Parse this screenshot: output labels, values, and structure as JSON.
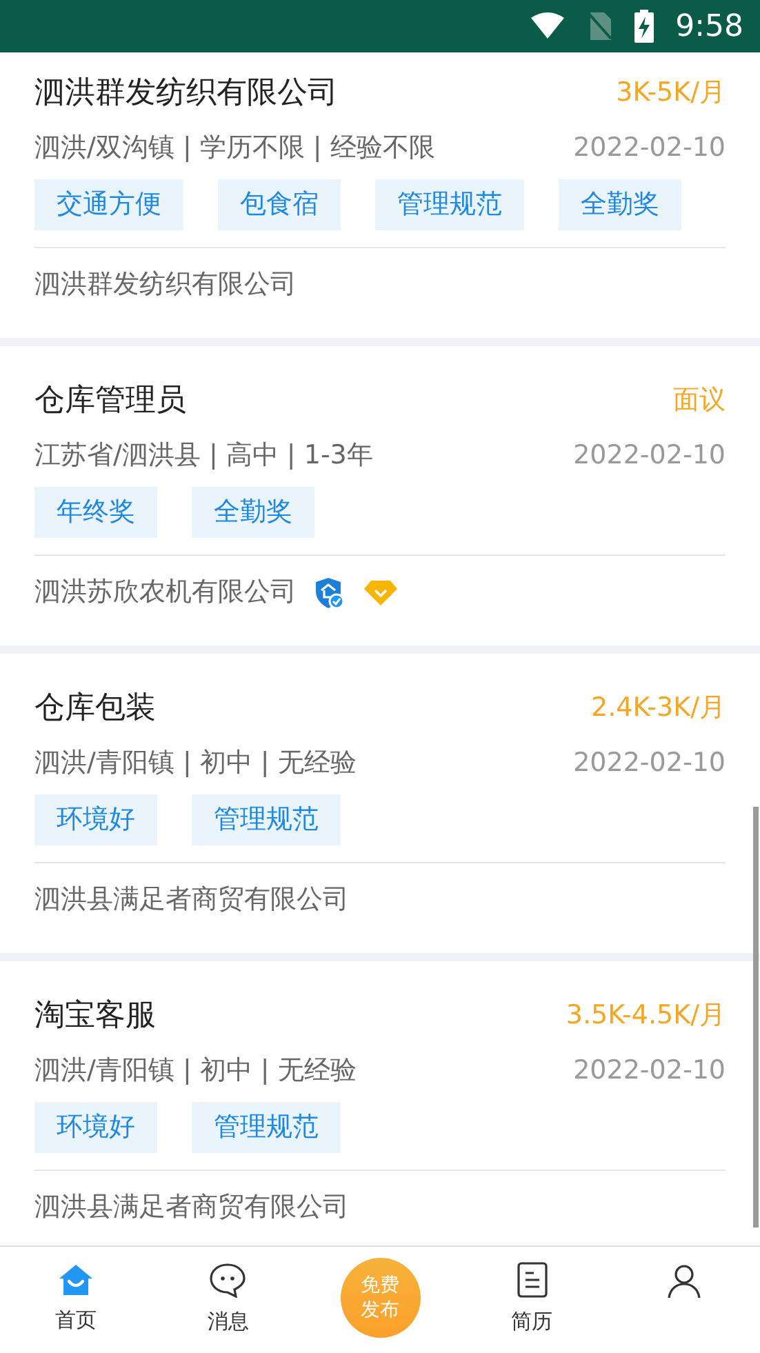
{
  "status_bar": {
    "time": "9:58"
  },
  "jobs": [
    {
      "title": "泗洪群发纺织有限公司",
      "salary": "3K-5K/月",
      "info": "泗洪/双沟镇 | 学历不限 | 经验不限",
      "date": "2022-02-10",
      "tags": [
        "交通方便",
        "包食宿",
        "管理规范",
        "全勤奖"
      ],
      "company": "泗洪群发纺织有限公司",
      "verified": false,
      "vip": false
    },
    {
      "title": "仓库管理员",
      "salary": "面议",
      "info": "江苏省/泗洪县 | 高中 | 1-3年",
      "date": "2022-02-10",
      "tags": [
        "年终奖",
        "全勤奖"
      ],
      "company": "泗洪苏欣农机有限公司",
      "verified": true,
      "vip": true
    },
    {
      "title": "仓库包装",
      "salary": "2.4K-3K/月",
      "info": "泗洪/青阳镇 | 初中 | 无经验",
      "date": "2022-02-10",
      "tags": [
        "环境好",
        "管理规范"
      ],
      "company": "泗洪县满足者商贸有限公司",
      "verified": false,
      "vip": false
    },
    {
      "title": "淘宝客服",
      "salary": "3.5K-4.5K/月",
      "info": "泗洪/青阳镇 | 初中 | 无经验",
      "date": "2022-02-10",
      "tags": [
        "环境好",
        "管理规范"
      ],
      "company": "泗洪县满足者商贸有限公司",
      "verified": false,
      "vip": false
    }
  ],
  "nav": [
    {
      "kind": "home",
      "label": "首页",
      "selected": true
    },
    {
      "kind": "message",
      "label": "消息",
      "selected": false
    },
    {
      "kind": "publish",
      "label": "免费发布",
      "selected": false
    },
    {
      "kind": "resume",
      "label": "简历",
      "selected": false
    },
    {
      "kind": "profile",
      "selected": false
    }
  ]
}
